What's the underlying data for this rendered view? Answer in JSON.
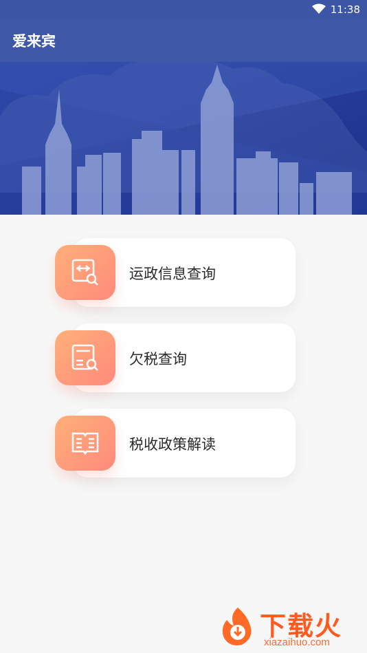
{
  "statusbar": {
    "time": "11:38"
  },
  "appbar": {
    "title": "爱来宾"
  },
  "menu": [
    {
      "label": "运政信息查询",
      "icon": "route-search-icon"
    },
    {
      "label": "欠税查询",
      "icon": "tax-owed-search-icon"
    },
    {
      "label": "税收政策解读",
      "icon": "tax-policy-book-icon"
    }
  ],
  "watermark": {
    "name": "下载火",
    "url": "xiazaihuo.com"
  },
  "colors": {
    "appbar": "#3f57a7",
    "accent_gradient_start": "#ffb07a",
    "accent_gradient_end": "#ff8a7b",
    "watermark": "#ff5a1f"
  }
}
